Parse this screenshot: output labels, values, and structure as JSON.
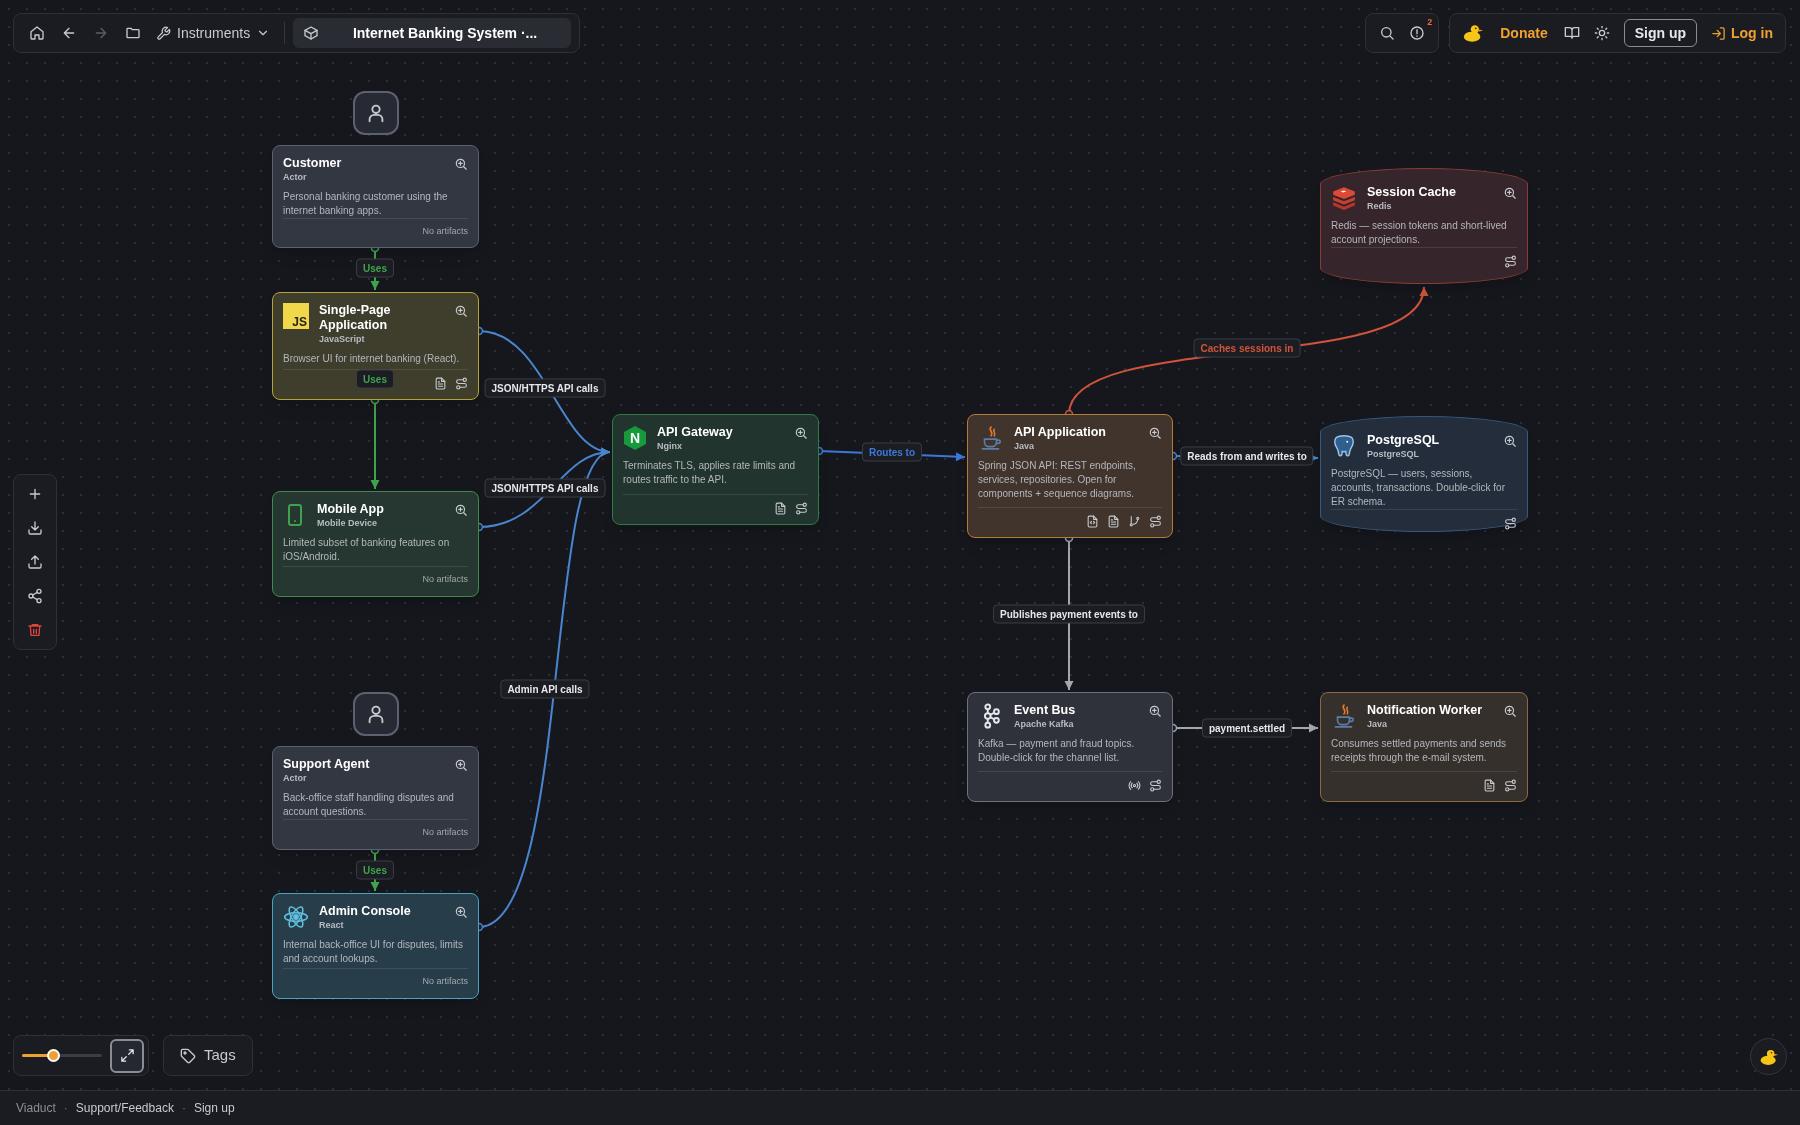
{
  "toolbar": {
    "nav": [
      {
        "kind": "home",
        "disabled": false
      },
      {
        "kind": "back",
        "disabled": false
      },
      {
        "kind": "forward",
        "disabled": true
      },
      {
        "kind": "folder",
        "disabled": false
      }
    ],
    "instruments": "Instruments",
    "diagram_title": "Internet Banking System ·..."
  },
  "header_actions": {
    "alerts_badge": "2",
    "donate": "Donate",
    "sign_up": "Sign up",
    "log_in": "Log in"
  },
  "nodes": [
    {
      "kind": "actor",
      "title": "Customer",
      "subtitle": "Actor",
      "description": "Personal banking customer using the internet banking apps.",
      "color": "#5b6170",
      "artifacts_note": "No artifacts"
    },
    {
      "kind": "container",
      "title": "Single-Page Application",
      "subtitle": "JavaScript",
      "description": "Browser UI for internet banking (React).",
      "color": "#b5a23a",
      "logo": {
        "kind": "js",
        "text": "JS"
      },
      "artifacts": [
        {
          "kind": "document"
        },
        {
          "kind": "flows"
        }
      ]
    },
    {
      "kind": "container",
      "title": "Mobile App",
      "subtitle": "Mobile Device",
      "description": "Limited subset of banking features on iOS/Android.",
      "color": "#3d8a4c",
      "logo": {
        "kind": "phone"
      },
      "artifacts_note": "No artifacts"
    },
    {
      "kind": "actor",
      "title": "Support Agent",
      "subtitle": "Actor",
      "description": "Back-office staff handling disputes and account questions.",
      "color": "#5b6170",
      "artifacts_note": "No artifacts"
    },
    {
      "kind": "container",
      "title": "Admin Console",
      "subtitle": "React",
      "description": "Internal back-office UI for disputes, limits and account lookups.",
      "color": "#4aa3c2",
      "logo": {
        "kind": "react"
      },
      "artifacts_note": "No artifacts"
    },
    {
      "kind": "container",
      "title": "API Gateway",
      "subtitle": "Nginx",
      "description": "Terminates TLS, applies rate limits and routes traffic to the API.",
      "color": "#2f7a45",
      "logo": {
        "kind": "nginx",
        "text": "N"
      },
      "artifacts": [
        {
          "kind": "document"
        },
        {
          "kind": "flows"
        }
      ]
    },
    {
      "kind": "container",
      "title": "API Application",
      "subtitle": "Java",
      "description": "Spring JSON API: REST endpoints, services, repositories. Open for components + sequence diagrams.",
      "color": "#b87a38",
      "logo": {
        "kind": "java"
      },
      "artifacts": [
        {
          "kind": "code-file"
        },
        {
          "kind": "document"
        },
        {
          "kind": "branch"
        },
        {
          "kind": "flows"
        }
      ]
    },
    {
      "kind": "container",
      "title": "Event Bus",
      "subtitle": "Apache Kafka",
      "description": "Kafka — payment and fraud topics. Double-click for the channel list.",
      "color": "#6b7280",
      "logo": {
        "kind": "kafka"
      },
      "artifacts": [
        {
          "kind": "broadcast"
        },
        {
          "kind": "flows"
        }
      ]
    },
    {
      "kind": "database",
      "title": "Session Cache",
      "subtitle": "Redis",
      "description": "Redis — session tokens and short-lived account projections.",
      "color": "#8a3a36",
      "logo": {
        "kind": "redis"
      },
      "artifacts": [
        {
          "kind": "flows"
        }
      ]
    },
    {
      "kind": "database",
      "title": "PostgreSQL",
      "subtitle": "PostgreSQL",
      "description": "PostgreSQL — users, sessions, accounts, transactions. Double-click for ER schema.",
      "color": "#35597e",
      "logo": {
        "kind": "postgres"
      },
      "artifacts": [
        {
          "kind": "flows"
        }
      ]
    },
    {
      "kind": "container",
      "title": "Notification Worker",
      "subtitle": "Java",
      "description": "Consumes settled payments and sends receipts through the e-mail system.",
      "color": "#8a6a40",
      "logo": {
        "kind": "java"
      },
      "artifacts": [
        {
          "kind": "document"
        },
        {
          "kind": "flows"
        }
      ]
    }
  ],
  "edges": [
    {
      "label": "Uses",
      "color": "#3fa34d",
      "label_tinted": true,
      "bidirectional": false
    },
    {
      "label": "Uses",
      "color": "#3fa34d",
      "label_tinted": true,
      "bidirectional": false
    },
    {
      "label": "JSON/HTTPS API calls",
      "color": "#4a86d0",
      "label_tinted": false,
      "bidirectional": false
    },
    {
      "label": "JSON/HTTPS API calls",
      "color": "#4a86d0",
      "label_tinted": false,
      "bidirectional": false
    },
    {
      "label": "Uses",
      "color": "#3fa34d",
      "label_tinted": true,
      "bidirectional": false
    },
    {
      "label": "Admin API calls",
      "color": "#4a86d0",
      "label_tinted": false,
      "bidirectional": false
    },
    {
      "label": "Routes to",
      "color": "#3b78d8",
      "label_tinted": true,
      "bidirectional": false
    },
    {
      "label": "Caches sessions in",
      "color": "#d0543c",
      "label_tinted": true,
      "bidirectional": false
    },
    {
      "label": "Reads from and writes to",
      "color": "#4a86d0",
      "label_tinted": false,
      "bidirectional": true
    },
    {
      "label": "Publishes payment events to",
      "color": "#a3a7b0",
      "label_tinted": false,
      "bidirectional": false
    },
    {
      "label": "payment.settled",
      "color": "#a3a7b0",
      "label_tinted": false,
      "bidirectional": false
    }
  ],
  "canvas_tools": [
    {
      "kind": "add"
    },
    {
      "kind": "download"
    },
    {
      "kind": "upload"
    },
    {
      "kind": "share"
    },
    {
      "kind": "delete"
    }
  ],
  "zoom": {
    "level": 0.38
  },
  "tags_button": "Tags",
  "footer": [
    {
      "kind": "link",
      "label": "Viaduct"
    },
    {
      "kind": "separator",
      "label": "·"
    },
    {
      "kind": "link",
      "label": "Support/Feedback"
    },
    {
      "kind": "separator",
      "label": "·"
    },
    {
      "kind": "link",
      "label": "Sign up"
    }
  ]
}
